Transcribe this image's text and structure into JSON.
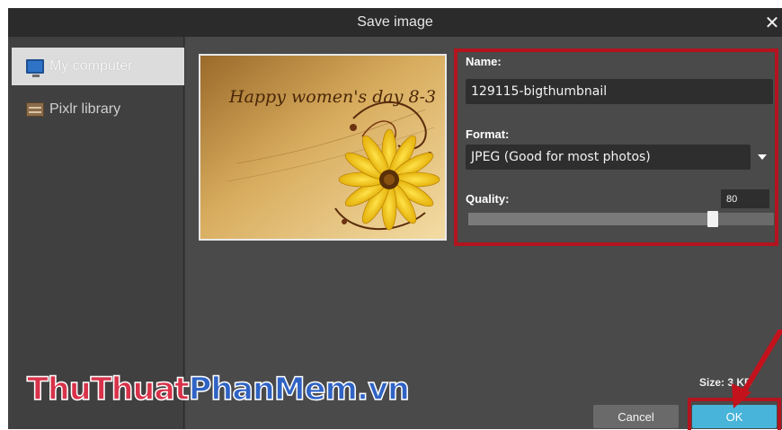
{
  "dialog": {
    "title": "Save image",
    "close_glyph": "✕"
  },
  "sidebar": {
    "items": [
      {
        "label": "My computer",
        "icon": "monitor-icon",
        "active": true
      },
      {
        "label": "Pixlr library",
        "icon": "library-icon",
        "active": false
      }
    ]
  },
  "preview": {
    "text": "Happy women's day 8-3"
  },
  "form": {
    "name_label": "Name:",
    "name_value": "129115-bigthumbnail",
    "format_label": "Format:",
    "format_value": "JPEG (Good for most photos)",
    "quality_label": "Quality:",
    "quality_value": "80",
    "quality_level": 0.8
  },
  "footer": {
    "size_label": "Size: 3 KB",
    "cancel_label": "Cancel",
    "ok_label": "OK"
  },
  "watermark": {
    "part1": "ThuThuat",
    "part2": "PhanMem.vn"
  },
  "colors": {
    "highlight": "#b3141e",
    "ok_button": "#48b4d9"
  }
}
